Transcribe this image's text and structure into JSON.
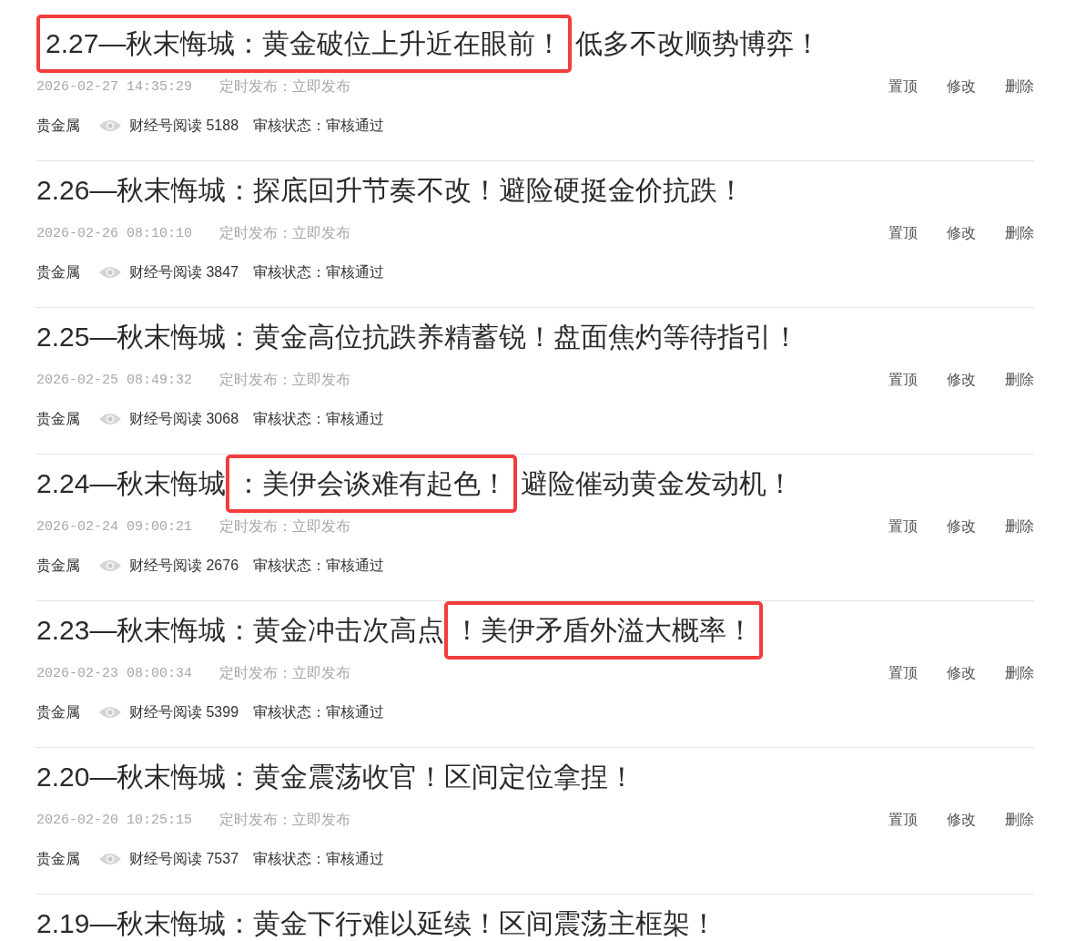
{
  "articles": [
    {
      "title_parts": [
        {
          "text": "2.27—秋末悔城：黄金破位上升近在眼前！",
          "boxed": true
        },
        {
          "text": "低多不改顺势博弈！",
          "boxed": false
        }
      ],
      "datetime": "2026-02-27 14:35:29",
      "schedule": "定时发布：立即发布",
      "actions": [
        "置顶",
        "修改",
        "删除"
      ],
      "category": "贵金属",
      "reads": "财经号阅读 5188",
      "review_status": "审核状态：审核通过"
    },
    {
      "title_parts": [
        {
          "text": "2.26—秋末悔城：探底回升节奏不改！避险硬挺金价抗跌！",
          "boxed": false
        }
      ],
      "datetime": "2026-02-26 08:10:10",
      "schedule": "定时发布：立即发布",
      "actions": [
        "置顶",
        "修改",
        "删除"
      ],
      "category": "贵金属",
      "reads": "财经号阅读 3847",
      "review_status": "审核状态：审核通过"
    },
    {
      "title_parts": [
        {
          "text": "2.25—秋末悔城：黄金高位抗跌养精蓄锐！盘面焦灼等待指引！",
          "boxed": false
        }
      ],
      "datetime": "2026-02-25 08:49:32",
      "schedule": "定时发布：立即发布",
      "actions": [
        "置顶",
        "修改",
        "删除"
      ],
      "category": "贵金属",
      "reads": "财经号阅读 3068",
      "review_status": "审核状态：审核通过"
    },
    {
      "title_parts": [
        {
          "text": "2.24—秋末悔城",
          "boxed": false
        },
        {
          "text": "：美伊会谈难有起色！",
          "boxed": true
        },
        {
          "text": "避险催动黄金发动机！",
          "boxed": false
        }
      ],
      "datetime": "2026-02-24 09:00:21",
      "schedule": "定时发布：立即发布",
      "actions": [
        "置顶",
        "修改",
        "删除"
      ],
      "category": "贵金属",
      "reads": "财经号阅读 2676",
      "review_status": "审核状态：审核通过"
    },
    {
      "title_parts": [
        {
          "text": "2.23—秋末悔城：黄金冲击次高点",
          "boxed": false
        },
        {
          "text": "！美伊矛盾外溢大概率！",
          "boxed": true
        }
      ],
      "datetime": "2026-02-23 08:00:34",
      "schedule": "定时发布：立即发布",
      "actions": [
        "置顶",
        "修改",
        "删除"
      ],
      "category": "贵金属",
      "reads": "财经号阅读 5399",
      "review_status": "审核状态：审核通过"
    },
    {
      "title_parts": [
        {
          "text": "2.20—秋末悔城：黄金震荡收官！区间定位拿捏！",
          "boxed": false
        }
      ],
      "datetime": "2026-02-20 10:25:15",
      "schedule": "定时发布：立即发布",
      "actions": [
        "置顶",
        "修改",
        "删除"
      ],
      "category": "贵金属",
      "reads": "财经号阅读 7537",
      "review_status": "审核状态：审核通过"
    },
    {
      "title_parts": [
        {
          "text": "2.19—秋末悔城：黄金下行难以延续！区间震荡主框架！",
          "boxed": false
        }
      ]
    }
  ]
}
